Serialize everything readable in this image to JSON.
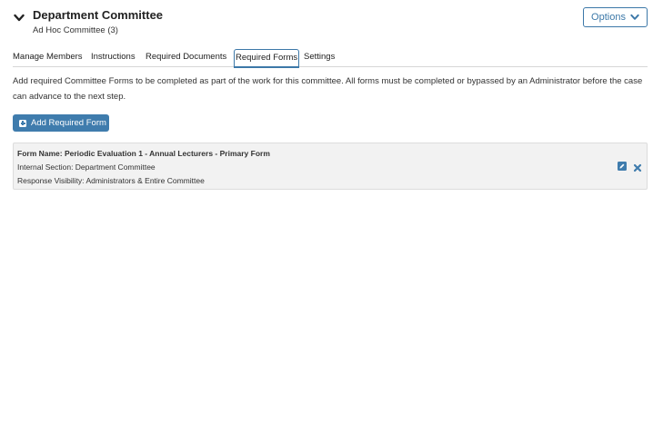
{
  "header": {
    "title": "Department Committee",
    "subtitle": "Ad Hoc Committee (3)",
    "options_label": "Options"
  },
  "tabs": [
    {
      "label": "Manage Members",
      "active": false
    },
    {
      "label": "Instructions",
      "active": false
    },
    {
      "label": "Required Documents",
      "active": false
    },
    {
      "label": "Required Forms",
      "active": true
    },
    {
      "label": "Settings",
      "active": false
    }
  ],
  "description": "Add required Committee Forms to be completed as part of the work for this committee. All forms must be completed or bypassed by an Administrator before the case can advance to the next step.",
  "add_button_label": "Add Required Form",
  "forms": [
    {
      "name": "Form Name: Periodic Evaluation 1 - Annual Lecturers - Primary Form",
      "section": "Internal Section: Department Committee",
      "visibility": "Response Visibility: Administrators & Entire Committee"
    }
  ],
  "colors": {
    "accent": "#3f7cad",
    "card_background": "#f2f2f2"
  },
  "icons": {
    "collapse": "chevron-down-icon",
    "options": "chevron-down-icon",
    "add": "plus-square-icon",
    "edit": "pencil-square-icon",
    "remove": "close-icon"
  }
}
